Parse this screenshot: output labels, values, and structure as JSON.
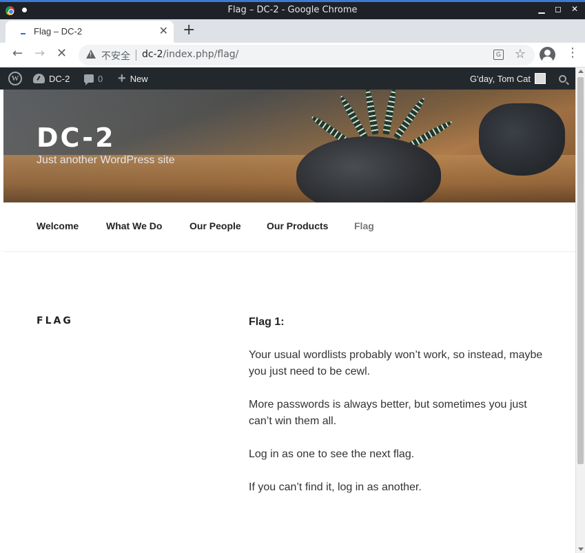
{
  "window": {
    "title": "Flag – DC-2 - Google Chrome"
  },
  "browser": {
    "tab_title": "Flag – DC-2",
    "security_label": "不安全",
    "url_host": "dc-2",
    "url_path": "/index.php/flag/",
    "new_tab_symbol": "+",
    "close_symbol": "✕"
  },
  "admin_bar": {
    "site_name": "DC-2",
    "comments_count": "0",
    "new_label": "New",
    "greeting": "G'day, Tom Cat"
  },
  "site": {
    "title": "DC-2",
    "description": "Just another WordPress site"
  },
  "nav": {
    "items": [
      {
        "label": "Welcome"
      },
      {
        "label": "What We Do"
      },
      {
        "label": "Our People"
      },
      {
        "label": "Our Products"
      },
      {
        "label": "Flag"
      }
    ]
  },
  "page": {
    "title": "FLAG",
    "heading": "Flag 1:",
    "paragraphs": [
      "Your usual wordlists probably won’t work, so instead, maybe you just need to be cewl.",
      "More passwords is always better, but sometimes you just can’t win them all.",
      "Log in as one to see the next flag.",
      "If you can’t find it, log in as another."
    ]
  },
  "icons": {
    "back": "arrow-left-icon",
    "forward": "arrow-right-icon",
    "reload": "loading-icon",
    "warning": "warning-icon",
    "translate": "translate-icon",
    "bookmark": "star-icon",
    "profile": "account-icon",
    "menu": "kebab-menu-icon"
  }
}
